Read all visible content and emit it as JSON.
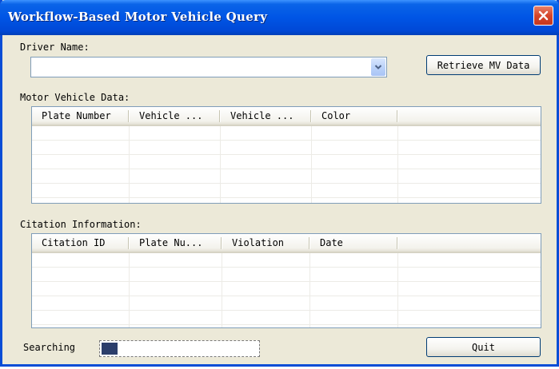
{
  "window": {
    "title": "Workflow-Based Motor Vehicle Query"
  },
  "driver": {
    "label": "Driver Name:",
    "value": ""
  },
  "retrieve_button": {
    "label": "Retrieve MV Data"
  },
  "mv_section": {
    "label": "Motor Vehicle Data:",
    "columns": [
      "Plate Number",
      "Vehicle ...",
      "Vehicle ...",
      "Color",
      ""
    ]
  },
  "citation_section": {
    "label": "Citation Information:",
    "columns": [
      "Citation ID",
      "Plate Nu...",
      "Violation",
      "Date",
      ""
    ]
  },
  "status": {
    "label": "Searching",
    "progress_fraction": 0.1
  },
  "quit_button": {
    "label": "Quit"
  },
  "icons": {
    "close": "close-icon",
    "dropdown": "chevron-down-icon"
  }
}
